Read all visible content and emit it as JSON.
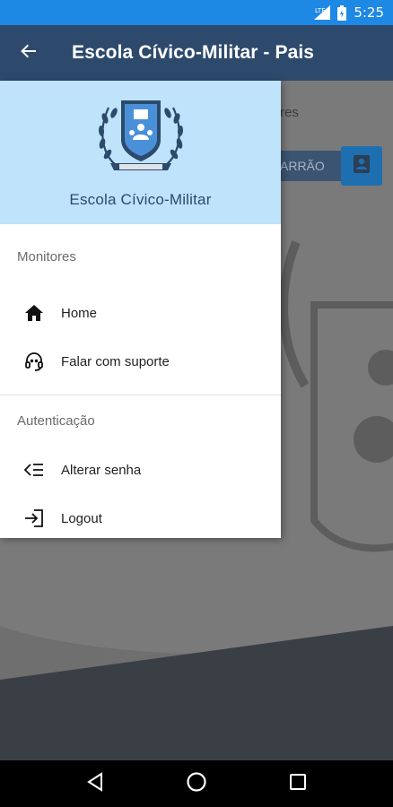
{
  "status_bar": {
    "time": "5:25",
    "icons": [
      "signal-icon",
      "battery-icon"
    ],
    "color": "#1e88e5"
  },
  "app_bar": {
    "title": "Escola Cívico-Militar - Pais",
    "back_icon": "arrow-back-icon",
    "color": "#2d4a6c"
  },
  "background": {
    "label_fragment": "res",
    "field_fragment": "ARRÃO",
    "button_icon": "contact-card-icon"
  },
  "drawer": {
    "header": {
      "school_name": "Escola Cívico-Militar",
      "logo_icon": "school-crest-icon",
      "color": "#bfe3fa"
    },
    "sections": [
      {
        "title": "Monitores",
        "items": [
          {
            "label": "Home",
            "icon": "home-icon"
          },
          {
            "label": "Falar com suporte",
            "icon": "headset-icon"
          }
        ]
      },
      {
        "title": "Autenticação",
        "items": [
          {
            "label": "Alterar senha",
            "icon": "password-icon"
          },
          {
            "label": "Logout",
            "icon": "logout-icon"
          }
        ]
      }
    ]
  },
  "nav_bar": {
    "buttons": [
      "back-triangle-icon",
      "home-circle-icon",
      "recents-square-icon"
    ]
  }
}
